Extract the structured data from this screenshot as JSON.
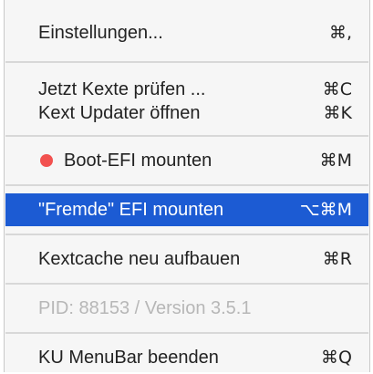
{
  "menu": {
    "items": [
      {
        "label": "Einstellungen...",
        "shortcut": "⌘,"
      },
      {
        "label": "Jetzt Kexte prüfen ...",
        "shortcut": "⌘C"
      },
      {
        "label": "Kext Updater öffnen",
        "shortcut": "⌘K"
      },
      {
        "label": "Boot-EFI mounten",
        "shortcut": "⌘M",
        "icon": "red-status-dot",
        "icon_color": "#f2514f"
      },
      {
        "label": "\"Fremde\" EFI mounten",
        "shortcut": "⌥⌘M",
        "selected": true
      },
      {
        "label": "Kextcache neu aufbauen",
        "shortcut": "⌘R"
      },
      {
        "label": "PID: 88153 / Version 3.5.1",
        "shortcut": "",
        "disabled": true
      },
      {
        "label": "KU MenuBar beenden",
        "shortcut": "⌘Q"
      }
    ]
  },
  "colors": {
    "selection": "#1c5bd3",
    "menu_background": "#f6f6f6",
    "disabled_text": "#b7b7b7"
  }
}
